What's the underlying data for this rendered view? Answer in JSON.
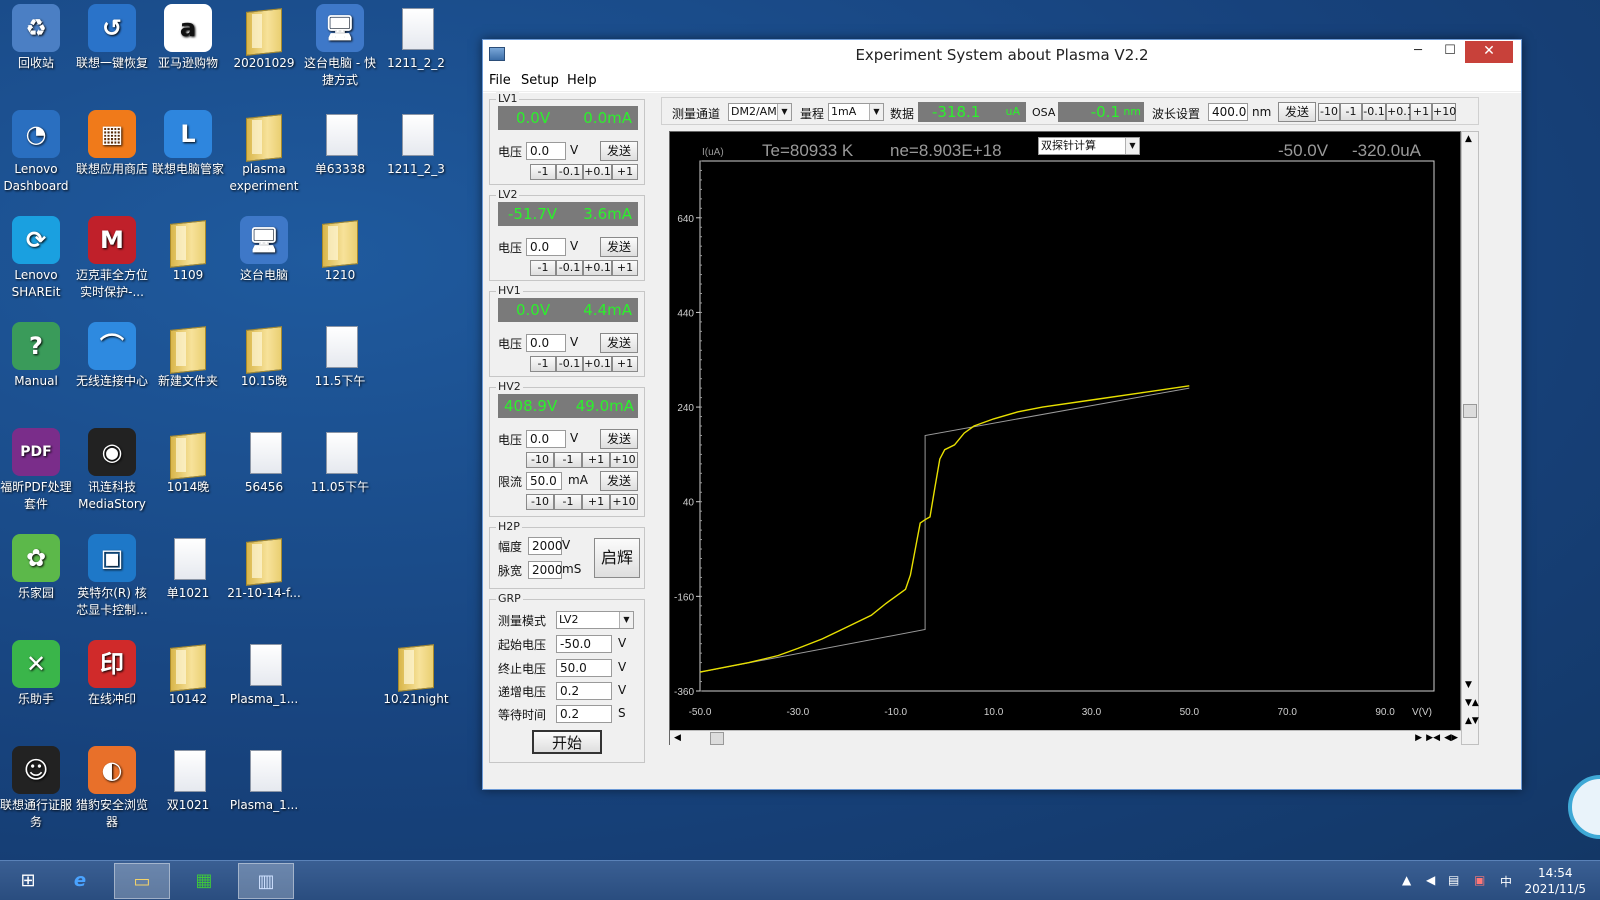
{
  "desktop": {
    "icons": [
      {
        "label": "回收站",
        "kind": "app",
        "color": "#4b7fc4",
        "glyph": "♻",
        "name": "recycle-bin-icon"
      },
      {
        "label": "联想一键恢复",
        "kind": "app",
        "color": "#2a73c9",
        "glyph": "↺",
        "name": "lenovo-recovery-icon"
      },
      {
        "label": "亚马逊购物",
        "kind": "app",
        "color": "#ffffff",
        "glyph": "a",
        "name": "amazon-icon"
      },
      {
        "label": "20201029",
        "kind": "folder",
        "name": "folder-icon"
      },
      {
        "label": "这台电脑 - 快捷方式",
        "kind": "app",
        "color": "#3e78c8",
        "glyph": "🖥",
        "name": "computer-shortcut-icon"
      },
      {
        "label": "1211_2_2",
        "kind": "file",
        "name": "file-icon"
      },
      {
        "label": "Lenovo Dashboard",
        "kind": "app",
        "color": "#2a6fc0",
        "glyph": "◔",
        "name": "lenovo-dashboard-icon"
      },
      {
        "label": "联想应用商店",
        "kind": "app",
        "color": "#f07a1a",
        "glyph": "▦",
        "name": "lenovo-app-store-icon"
      },
      {
        "label": "联想电脑管家",
        "kind": "app",
        "color": "#2e86de",
        "glyph": "L",
        "name": "lenovo-pc-manager-icon"
      },
      {
        "label": "plasma experiment",
        "kind": "folder",
        "name": "folder-icon"
      },
      {
        "label": "单63338",
        "kind": "file",
        "name": "file-icon"
      },
      {
        "label": "1211_2_3",
        "kind": "file",
        "name": "file-icon"
      },
      {
        "label": "Lenovo SHAREit",
        "kind": "app",
        "color": "#1aa0e0",
        "glyph": "⟳",
        "name": "shareit-icon"
      },
      {
        "label": "迈克菲全方位实时保护-...",
        "kind": "app",
        "color": "#c0202a",
        "glyph": "M",
        "name": "mcafee-icon"
      },
      {
        "label": "1109",
        "kind": "folder",
        "name": "folder-icon"
      },
      {
        "label": "这台电脑",
        "kind": "app",
        "color": "#3e78c8",
        "glyph": "🖥",
        "name": "this-pc-icon"
      },
      {
        "label": "1210",
        "kind": "folder",
        "name": "folder-icon"
      },
      {
        "label": "Manual",
        "kind": "app",
        "color": "#3a9b5a",
        "glyph": "?",
        "name": "manual-icon"
      },
      {
        "label": "无线连接中心",
        "kind": "app",
        "color": "#2e8ae0",
        "glyph": "⌒",
        "name": "wireless-center-icon"
      },
      {
        "label": "新建文件夹",
        "kind": "folder",
        "name": "folder-icon"
      },
      {
        "label": "10.15晚",
        "kind": "folder",
        "name": "folder-icon"
      },
      {
        "label": "11.5下午",
        "kind": "file",
        "name": "file-icon"
      },
      {
        "label": "福昕PDF处理套件",
        "kind": "app",
        "color": "#7a2d8a",
        "glyph": "PDF",
        "name": "foxit-pdf-icon"
      },
      {
        "label": "讯连科技 MediaStory",
        "kind": "app",
        "color": "#222222",
        "glyph": "◉",
        "name": "mediastory-icon"
      },
      {
        "label": "1014晚",
        "kind": "folder",
        "name": "folder-icon"
      },
      {
        "label": "56456",
        "kind": "file",
        "name": "file-icon"
      },
      {
        "label": "11.05下午",
        "kind": "file",
        "name": "file-icon"
      },
      {
        "label": "乐家园",
        "kind": "app",
        "color": "#5cb84a",
        "glyph": "✿",
        "name": "lejiayuan-icon"
      },
      {
        "label": "英特尔(R) 核芯显卡控制...",
        "kind": "app",
        "color": "#1e78c8",
        "glyph": "▣",
        "name": "intel-graphics-icon"
      },
      {
        "label": "单1021",
        "kind": "file",
        "name": "file-icon"
      },
      {
        "label": "21-10-14-f...",
        "kind": "folder",
        "name": "folder-icon"
      },
      {
        "label": "乐助手",
        "kind": "app",
        "color": "#3ab54a",
        "glyph": "✕",
        "name": "lezhushou-icon"
      },
      {
        "label": "在线冲印",
        "kind": "app",
        "color": "#d02a2a",
        "glyph": "印",
        "name": "online-print-icon"
      },
      {
        "label": "10142",
        "kind": "folder",
        "name": "folder-icon"
      },
      {
        "label": "Plasma_1...",
        "kind": "file",
        "name": "file-icon"
      },
      {
        "label": "10.21night",
        "kind": "folder",
        "name": "folder-icon"
      },
      {
        "label": "联想通行证服务",
        "kind": "app",
        "color": "#222222",
        "glyph": "☺",
        "name": "lenovo-id-icon"
      },
      {
        "label": "猎豹安全浏览器",
        "kind": "app",
        "color": "#e8702a",
        "glyph": "◐",
        "name": "liebao-browser-icon"
      },
      {
        "label": "双1021",
        "kind": "file",
        "name": "file-icon"
      },
      {
        "label": "Plasma_1...",
        "kind": "file",
        "name": "file-icon"
      }
    ]
  },
  "window": {
    "title": "Experiment System about Plasma V2.2",
    "minimize": "─",
    "maximize": "☐",
    "close": "✕",
    "menu": [
      "File",
      "Setup",
      "Help"
    ]
  },
  "panels": {
    "lv1": {
      "title": "LV1",
      "volt": "0.0V",
      "curr": "0.0mA",
      "label": "电压",
      "input": "0.0",
      "unit": "V",
      "send": "发送",
      "steps": [
        "-1",
        "-0.1",
        "+0.1",
        "+1"
      ]
    },
    "lv2": {
      "title": "LV2",
      "volt": "-51.7V",
      "curr": "3.6mA",
      "label": "电压",
      "input": "0.0",
      "unit": "V",
      "send": "发送",
      "steps": [
        "-1",
        "-0.1",
        "+0.1",
        "+1"
      ]
    },
    "hv1": {
      "title": "HV1",
      "volt": "0.0V",
      "curr": "4.4mA",
      "label": "电压",
      "input": "0.0",
      "unit": "V",
      "send": "发送",
      "steps": [
        "-1",
        "-0.1",
        "+0.1",
        "+1"
      ]
    },
    "hv2": {
      "title": "HV2",
      "volt": "408.9V",
      "curr": "49.0mA",
      "label": "电压",
      "input": "0.0",
      "unit": "V",
      "send": "发送",
      "steps": [
        "-10",
        "-1",
        "+1",
        "+10"
      ],
      "limit_label": "限流",
      "limit_input": "50.0",
      "limit_unit": "mA",
      "limit_send": "发送",
      "limit_steps": [
        "-10",
        "-1",
        "+1",
        "+10"
      ]
    },
    "h2p": {
      "title": "H2P",
      "amp_label": "幅度",
      "amp": "2000",
      "amp_unit": "V",
      "width_label": "脉宽",
      "width": "2000",
      "width_unit": "mS",
      "start": "启辉"
    },
    "grp": {
      "title": "GRP",
      "mode_label": "测量模式",
      "mode": "LV2",
      "start_label": "起始电压",
      "start": "-50.0",
      "end_label": "终止电压",
      "end": "50.0",
      "step_label": "递增电压",
      "step": "0.2",
      "wait_label": "等待时间",
      "wait": "0.2",
      "v": "V",
      "s": "S",
      "run": "开始"
    }
  },
  "toolbar": {
    "channel_label": "测量通道",
    "channel": "DM2/AM",
    "range_label": "量程",
    "range": "1mA",
    "data_label": "数据",
    "data_value": "-318.1",
    "data_unit": "uA",
    "osa_label": "OSA",
    "osa_value": "-0.1",
    "osa_unit": "nm",
    "wl_label": "波长设置",
    "wl": "400.0",
    "wl_unit": "nm",
    "send": "发送",
    "steps": [
      "-10",
      "-1",
      "-0.1",
      "+0.1",
      "+1",
      "+10"
    ]
  },
  "plot": {
    "te": "Te=80933 K",
    "ne": "ne=8.903E+18",
    "method": "双探针计算",
    "v_readout": "-50.0V",
    "i_readout": "-320.0uA",
    "ylabel": "I(uA)",
    "xlabel": "V(V)"
  },
  "chart_data": {
    "type": "line",
    "title": "",
    "xlabel": "V(V)",
    "ylabel": "I(uA)",
    "xlim": [
      -50,
      100
    ],
    "ylim": [
      -360,
      760
    ],
    "x_ticks": [
      "-50.0",
      "-30.0",
      "-10.0",
      "10.0",
      "30.0",
      "50.0",
      "70.0",
      "90.0"
    ],
    "y_ticks": [
      "-360",
      "-160",
      "40",
      "240",
      "440",
      "640"
    ],
    "grid": false,
    "series": [
      {
        "color": "#e8e000",
        "x": [
          -50,
          -40,
          -34,
          -30,
          -25,
          -20,
          -15,
          -12,
          -10,
          -8,
          -7,
          -6,
          -5,
          -4,
          -3,
          -2,
          -1,
          0,
          2,
          4,
          6,
          10,
          15,
          20,
          30,
          40,
          50
        ],
        "y": [
          -320,
          -300,
          -285,
          -270,
          -250,
          -225,
          -200,
          -175,
          -160,
          -145,
          -115,
          -60,
          -5,
          2,
          8,
          70,
          130,
          150,
          160,
          185,
          200,
          215,
          230,
          240,
          255,
          270,
          285
        ]
      },
      {
        "color": "#9a9a9a",
        "x": [
          -50,
          -4,
          -4,
          -4,
          50
        ],
        "y": [
          -320,
          -230,
          -230,
          180,
          280
        ]
      }
    ]
  },
  "taskbar": {
    "time": "14:54",
    "date": "2021/11/5",
    "ime": "中",
    "up_arrow": "▲"
  }
}
